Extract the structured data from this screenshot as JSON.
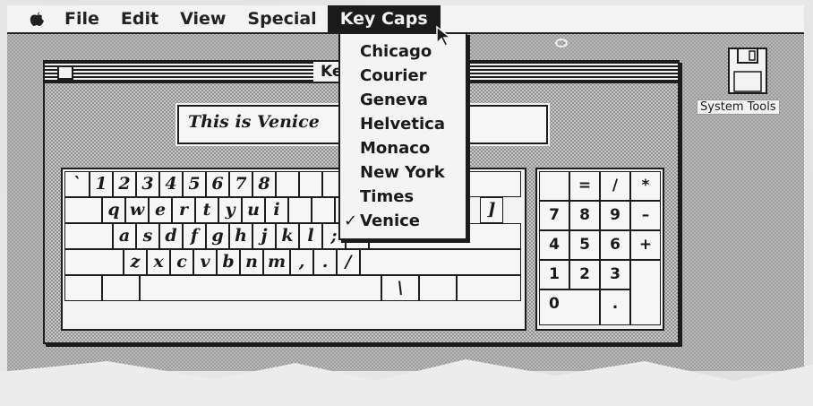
{
  "menubar": {
    "apple_icon": "apple-icon",
    "items": [
      "File",
      "Edit",
      "View",
      "Special",
      "Key Caps"
    ],
    "active_index": 4
  },
  "window": {
    "title": "Key Caps",
    "sample_text": "This is Venice"
  },
  "dropdown": {
    "items": [
      "Chicago",
      "Courier",
      "Geneva",
      "Helvetica",
      "Monaco",
      "New York",
      "Times",
      "Venice"
    ],
    "checked": "Venice",
    "check_mark": "✓"
  },
  "keyboard": {
    "row1": [
      "`",
      "1",
      "2",
      "3",
      "4",
      "5",
      "6",
      "7",
      "8"
    ],
    "row2": [
      "q",
      "w",
      "e",
      "r",
      "t",
      "y",
      "u",
      "i"
    ],
    "row2_tail": "]",
    "row3": [
      "a",
      "s",
      "d",
      "f",
      "g",
      "h",
      "j",
      "k",
      "l",
      ";",
      "'"
    ],
    "row4": [
      "z",
      "x",
      "c",
      "v",
      "b",
      "n",
      "m",
      ",",
      ".",
      "/"
    ],
    "row5_backslash": "\\"
  },
  "keypad": {
    "rows": [
      [
        "",
        "=",
        "/",
        "*"
      ],
      [
        "7",
        "8",
        "9",
        "–"
      ],
      [
        "4",
        "5",
        "6",
        "+"
      ],
      [
        "1",
        "2",
        "3",
        ""
      ],
      [
        "0",
        "",
        ".",
        ""
      ]
    ]
  },
  "desktop": {
    "disk_label": "System Tools",
    "disk_icon": "floppy-disk-icon"
  },
  "colors": {
    "ink": "#1c1c1c",
    "paper": "#f3f3f3",
    "highlight": "#1b1b1b"
  }
}
